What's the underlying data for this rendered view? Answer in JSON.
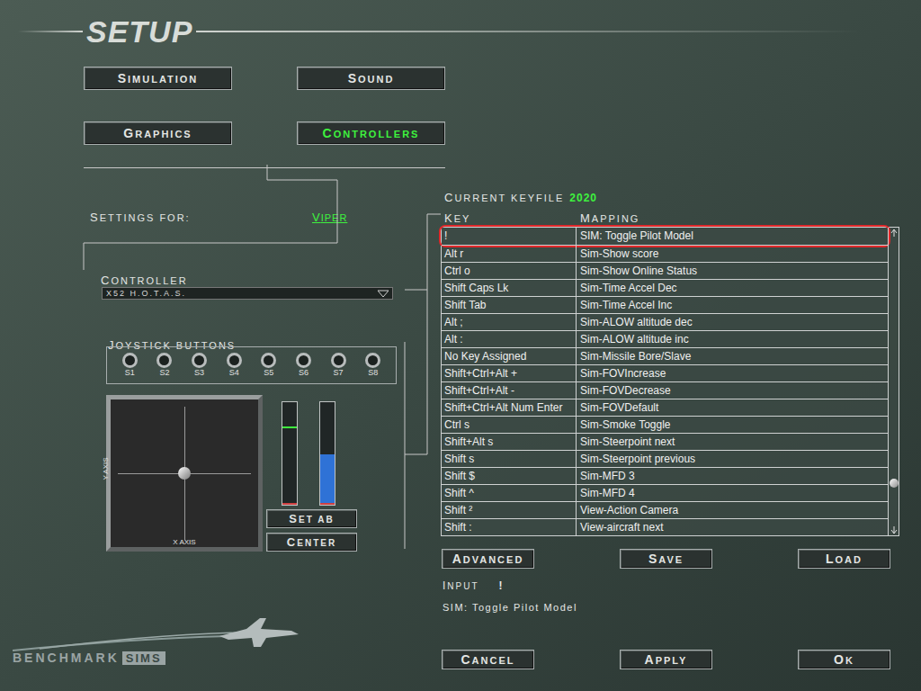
{
  "title": "SETUP",
  "tabs": [
    {
      "label": "SIMULATION",
      "selected": false
    },
    {
      "label": "SOUND",
      "selected": false
    },
    {
      "label": "GRAPHICS",
      "selected": false
    },
    {
      "label": "CONTROLLERS",
      "selected": true
    }
  ],
  "settings_for": {
    "label": "SETTINGS FOR:",
    "value": "VIPER"
  },
  "controller": {
    "label": "CONTROLLER",
    "value": "X52 H.O.T.A.S."
  },
  "joystick_buttons": {
    "label": "JOYSTICK BUTTONS",
    "buttons": [
      {
        "label": "S1",
        "pressed": false
      },
      {
        "label": "S2",
        "pressed": false
      },
      {
        "label": "S3",
        "pressed": false
      },
      {
        "label": "S4",
        "pressed": false
      },
      {
        "label": "S5",
        "pressed": false
      },
      {
        "label": "S6",
        "pressed": false
      },
      {
        "label": "S7",
        "pressed": false
      },
      {
        "label": "S8",
        "pressed": false
      }
    ]
  },
  "stick": {
    "x_label": "X AXIS",
    "y_label": "Y AXIS",
    "x": 0.5,
    "y": 0.5
  },
  "throttle_bars": [
    {
      "kind": "marker",
      "level": 0.75
    },
    {
      "kind": "fill",
      "level": 0.49
    }
  ],
  "stick_buttons": [
    "SET AB",
    "CENTER"
  ],
  "keyfile": {
    "label": "CURRENT KEYFILE",
    "value": "2020"
  },
  "table": {
    "columns": [
      "KEY",
      "MAPPING"
    ],
    "scroll_level": 0.85,
    "rows": [
      {
        "key": "!",
        "mapping": "SIM: Toggle Pilot Model",
        "selected": true
      },
      {
        "key": "Alt r",
        "mapping": "Sim-Show score",
        "selected": false
      },
      {
        "key": "Ctrl o",
        "mapping": "Sim-Show Online Status",
        "selected": false
      },
      {
        "key": "Shift Caps Lk",
        "mapping": "Sim-Time Accel Dec",
        "selected": false
      },
      {
        "key": "Shift Tab",
        "mapping": "Sim-Time Accel Inc",
        "selected": false
      },
      {
        "key": "Alt ;",
        "mapping": "Sim-ALOW altitude dec",
        "selected": false
      },
      {
        "key": "Alt :",
        "mapping": "Sim-ALOW altitude inc",
        "selected": false
      },
      {
        "key": "No Key Assigned",
        "mapping": "Sim-Missile Bore/Slave",
        "selected": false
      },
      {
        "key": "Shift+Ctrl+Alt +",
        "mapping": "Sim-FOVIncrease",
        "selected": false
      },
      {
        "key": "Shift+Ctrl+Alt -",
        "mapping": "Sim-FOVDecrease",
        "selected": false
      },
      {
        "key": "Shift+Ctrl+Alt Num Enter",
        "mapping": "Sim-FOVDefault",
        "selected": false
      },
      {
        "key": "Ctrl s",
        "mapping": "Sim-Smoke Toggle",
        "selected": false
      },
      {
        "key": "Shift+Alt s",
        "mapping": "Sim-Steerpoint next",
        "selected": false
      },
      {
        "key": "Shift s",
        "mapping": "Sim-Steerpoint previous",
        "selected": false
      },
      {
        "key": "Shift $",
        "mapping": "Sim-MFD 3",
        "selected": false
      },
      {
        "key": "Shift ^",
        "mapping": "Sim-MFD 4",
        "selected": false
      },
      {
        "key": "Shift ²",
        "mapping": "View-Action Camera",
        "selected": false
      },
      {
        "key": "Shift :",
        "mapping": "View-aircraft next",
        "selected": false
      }
    ]
  },
  "file_buttons": [
    "ADVANCED",
    "SAVE",
    "LOAD"
  ],
  "input": {
    "label": "INPUT",
    "value": "!",
    "description": "SIM: Toggle Pilot Model"
  },
  "dialog_buttons": [
    "CANCEL",
    "APPLY",
    "OK"
  ],
  "logo": {
    "name": "BENCHMARK",
    "suffix": "SIMS"
  }
}
